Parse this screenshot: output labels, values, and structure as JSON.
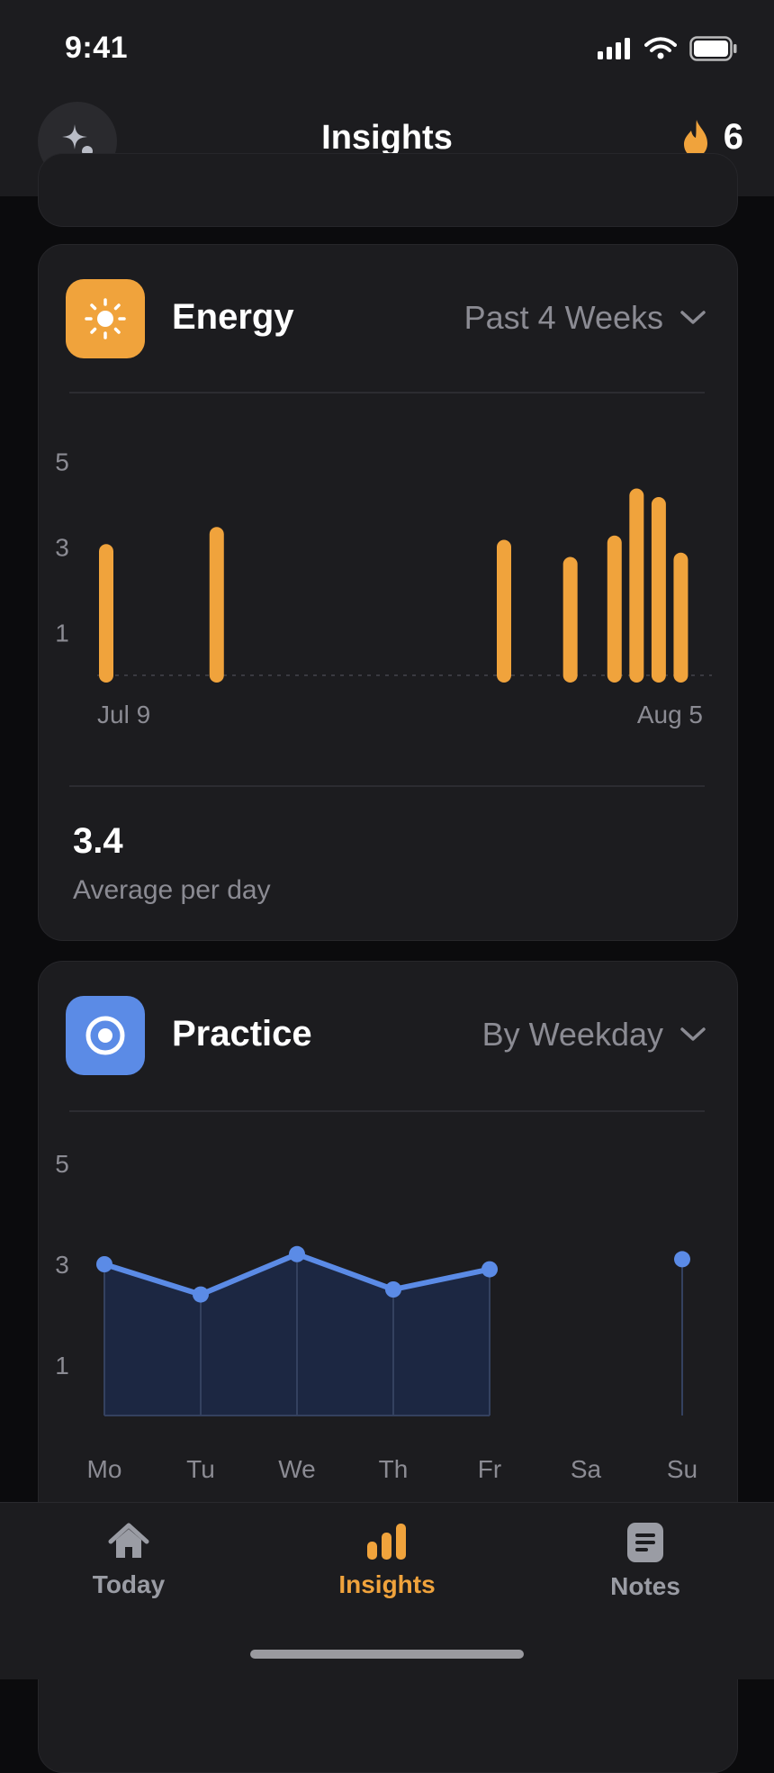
{
  "status_bar": {
    "time": "9:41"
  },
  "header": {
    "title": "Insights",
    "streak_count": "6",
    "accent": "#F0A33C"
  },
  "energy_card": {
    "title": "Energy",
    "range_label": "Past 4 Weeks",
    "icon": "sun-icon",
    "icon_color": "#F0A33C",
    "average_value": "3.4",
    "average_label": "Average per day"
  },
  "practice_card": {
    "title": "Practice",
    "range_label": "By Weekday",
    "icon": "target-icon",
    "icon_color": "#5B8BE6"
  },
  "tabs": [
    {
      "label": "Today",
      "icon": "home-icon",
      "active": false
    },
    {
      "label": "Insights",
      "icon": "bar-chart-icon",
      "active": true
    },
    {
      "label": "Notes",
      "icon": "note-icon",
      "active": false
    }
  ],
  "chart_data": [
    {
      "type": "bar",
      "title": "",
      "ylim": [
        0,
        5
      ],
      "y_ticks": [
        "5",
        "3",
        "1"
      ],
      "x_tick_labels": [
        "Jul 9",
        "Aug 5"
      ],
      "x": [
        "2023-07-09",
        "2023-07-14",
        "2023-07-27",
        "2023-07-30",
        "2023-08-01",
        "2023-08-02",
        "2023-08-03",
        "2023-08-04"
      ],
      "values": [
        2.9,
        3.3,
        3.0,
        2.6,
        3.1,
        4.2,
        4.0,
        2.7
      ],
      "color": "#F0A33C"
    },
    {
      "type": "area",
      "title": "",
      "ylim": [
        0,
        5
      ],
      "y_ticks": [
        "5",
        "3",
        "1"
      ],
      "categories": [
        "Mo",
        "Tu",
        "We",
        "Th",
        "Fr",
        "Sa",
        "Su"
      ],
      "values": [
        3.0,
        2.4,
        3.2,
        2.5,
        2.9,
        null,
        3.1
      ],
      "color": "#5B8BE6"
    }
  ]
}
